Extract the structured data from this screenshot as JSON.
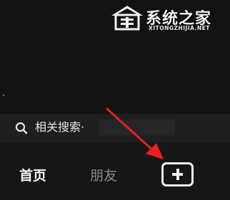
{
  "watermark": {
    "title": "系统之家",
    "url": "XITONGZHIJIA.NET"
  },
  "search": {
    "label": "相关搜索·"
  },
  "bottom_nav": {
    "home": "首页",
    "friends": "朋友"
  },
  "colors": {
    "background": "#161616",
    "annotation_arrow": "#e8201f"
  },
  "icons": [
    "logo-house-icon",
    "search-icon",
    "plus-icon",
    "arrow-annotation"
  ]
}
